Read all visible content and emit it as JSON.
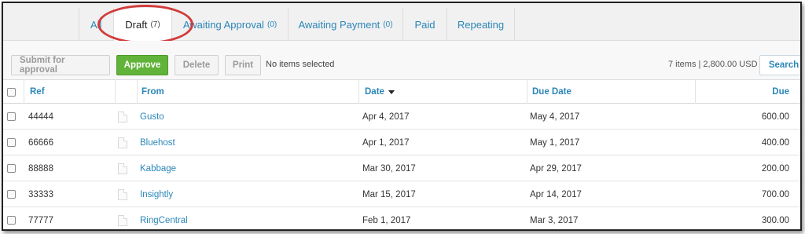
{
  "tabs": [
    {
      "label": "All",
      "count": ""
    },
    {
      "label": "Draft",
      "count": "(7)"
    },
    {
      "label": "Awaiting Approval",
      "count": "(0)"
    },
    {
      "label": "Awaiting Payment",
      "count": "(0)"
    },
    {
      "label": "Paid",
      "count": ""
    },
    {
      "label": "Repeating",
      "count": ""
    }
  ],
  "toolbar": {
    "submit_label": "Submit for approval",
    "approve_label": "Approve",
    "delete_label": "Delete",
    "print_label": "Print",
    "selection_status": "No items selected",
    "summary": "7 items | 2,800.00 USD",
    "search_label": "Search"
  },
  "table": {
    "headers": {
      "ref": "Ref",
      "from": "From",
      "date": "Date",
      "due_date": "Due Date",
      "due": "Due"
    },
    "rows": [
      {
        "ref": "44444",
        "from": "Gusto",
        "date": "Apr 4, 2017",
        "due_date": "May 4, 2017",
        "due": "600.00"
      },
      {
        "ref": "66666",
        "from": "Bluehost",
        "date": "Apr 1, 2017",
        "due_date": "May 1, 2017",
        "due": "400.00"
      },
      {
        "ref": "88888",
        "from": "Kabbage",
        "date": "Mar 30, 2017",
        "due_date": "Apr 29, 2017",
        "due": "200.00"
      },
      {
        "ref": "33333",
        "from": "Insightly",
        "date": "Mar 15, 2017",
        "due_date": "Apr 14, 2017",
        "due": "700.00"
      },
      {
        "ref": "77777",
        "from": "RingCentral",
        "date": "Feb 1, 2017",
        "due_date": "Mar 3, 2017",
        "due": "300.00"
      }
    ]
  },
  "colors": {
    "accent": "#2b86b8",
    "approve": "#62b33a",
    "highlight_ellipse": "#d13b3b"
  }
}
